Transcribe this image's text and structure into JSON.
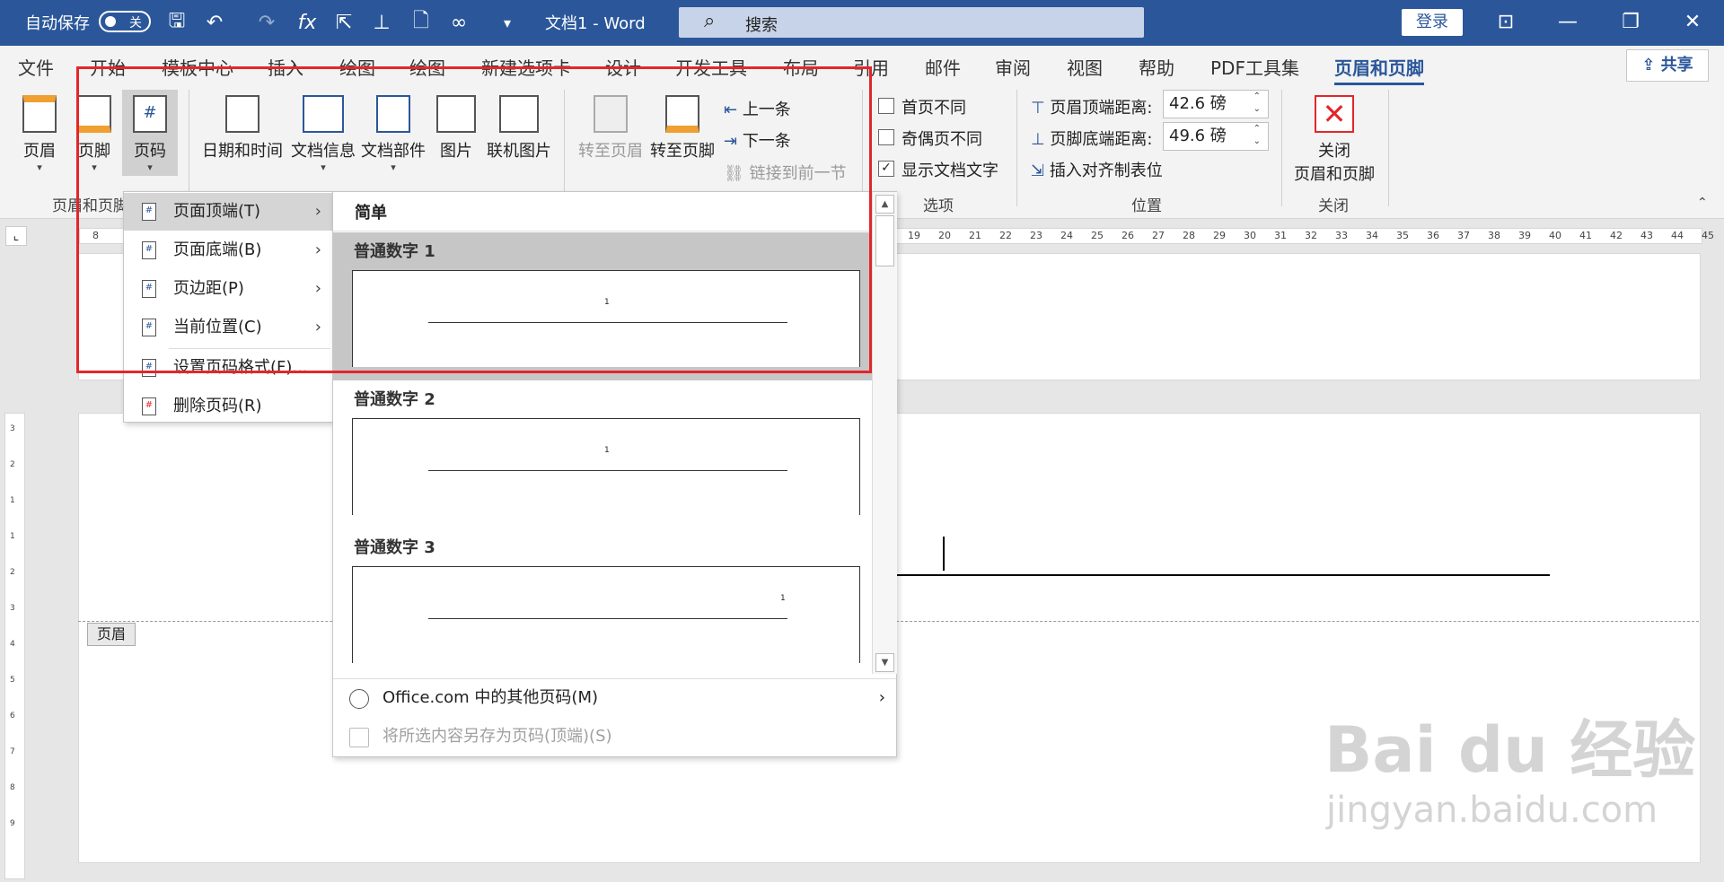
{
  "titlebar": {
    "autosave": "自动保存",
    "autosave_state": "关",
    "doc_title": "文档1  -  Word",
    "search_placeholder": "搜索",
    "login": "登录",
    "fx": "fx"
  },
  "tabs": [
    "文件",
    "开始",
    "模板中心",
    "插入",
    "绘图",
    "绘图",
    "新建选项卡",
    "设计",
    "开发工具",
    "布局",
    "引用",
    "邮件",
    "审阅",
    "视图",
    "帮助",
    "PDF工具集",
    "页眉和页脚"
  ],
  "share": "共享",
  "ribbon": {
    "header": "页眉",
    "footer": "页脚",
    "page_number": "页码",
    "group1": "页眉和页脚",
    "datetime": "日期和时间",
    "docinfo": "文档信息",
    "docparts": "文档部件",
    "picture": "图片",
    "online_picture": "联机图片",
    "goto_header": "转至页眉",
    "goto_footer": "转至页脚",
    "prev": "上一条",
    "next": "下一条",
    "link_prev": "链接到前一节",
    "diff_first": "首页不同",
    "diff_odd_even": "奇偶页不同",
    "show_doc_text": "显示文档文字",
    "options_group": "选项",
    "header_top": "页眉顶端距离:",
    "header_top_value": "42.6 磅",
    "footer_bottom": "页脚底端距离:",
    "footer_bottom_value": "49.6 磅",
    "insert_align_tab": "插入对齐制表位",
    "position_group": "位置",
    "close_line1": "关闭",
    "close_line2": "页眉和页脚",
    "close_group": "关闭"
  },
  "ruler_ticks": [
    "8",
    "19",
    "20",
    "21",
    "22",
    "23",
    "24",
    "25",
    "26",
    "27",
    "28",
    "29",
    "30",
    "31",
    "32",
    "33",
    "34",
    "35",
    "36",
    "37",
    "38",
    "39",
    "40",
    "41",
    "42",
    "43",
    "44",
    "45"
  ],
  "vruler_ticks": [
    "3",
    "2",
    "1",
    "1",
    "2",
    "3",
    "4",
    "5",
    "6",
    "7",
    "8",
    "9"
  ],
  "menu1": [
    {
      "label": "页面顶端(T)",
      "hl": true
    },
    {
      "label": "页面底端(B)"
    },
    {
      "label": "页边距(P)"
    },
    {
      "label": "当前位置(C)"
    },
    {
      "label": "设置页码格式(F)..."
    },
    {
      "label": "删除页码(R)"
    }
  ],
  "menu2": {
    "section": "简单",
    "items": [
      {
        "title": "普通数字 1",
        "num": "1"
      },
      {
        "title": "普通数字 2",
        "num": "1"
      },
      {
        "title": "普通数字 3",
        "num": "1"
      }
    ],
    "more": "Office.com 中的其他页码(M)",
    "save": "将所选内容另存为页码(顶端)(S)"
  },
  "page": {
    "header_tag": "页眉"
  },
  "watermark": {
    "main": "Bai du 经验",
    "sub": "jingyan.baidu.com"
  }
}
